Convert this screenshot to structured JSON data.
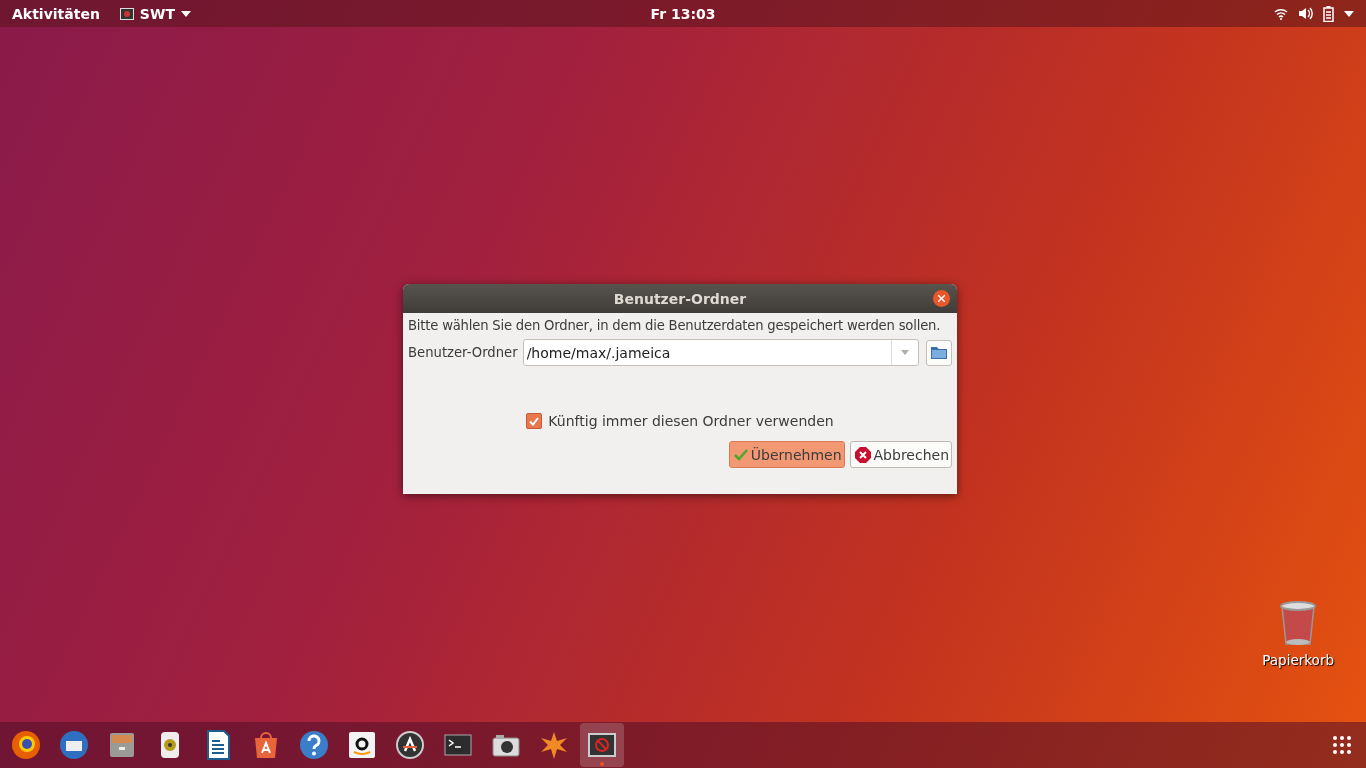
{
  "top_bar": {
    "activities": "Aktivitäten",
    "app_menu": "SWT",
    "clock": "Fr 13:03"
  },
  "dialog": {
    "title": "Benutzer-Ordner",
    "message": "Bitte wählen Sie den Ordner, in dem die Benutzerdaten gespeichert werden sollen.",
    "field_label": "Benutzer-Ordner",
    "path_value": "/home/max/.jameica",
    "remember": {
      "label": "Künftig immer diesen Ordner verwenden",
      "checked": true
    },
    "buttons": [
      {
        "label": "Übernehmen",
        "kind": "ok",
        "default": true
      },
      {
        "label": "Abbrechen",
        "kind": "cancel",
        "default": false
      }
    ]
  },
  "desktop_icons": [
    {
      "label": "Papierkorb"
    }
  ],
  "dock": [
    {
      "kind": "browser",
      "running": false
    },
    {
      "kind": "mail",
      "running": false
    },
    {
      "kind": "files",
      "running": false
    },
    {
      "kind": "speaker",
      "running": false
    },
    {
      "kind": "writer",
      "running": false
    },
    {
      "kind": "store",
      "running": false
    },
    {
      "kind": "help",
      "running": false
    },
    {
      "kind": "amazon",
      "running": false
    },
    {
      "kind": "updater",
      "running": false
    },
    {
      "kind": "terminal",
      "running": false
    },
    {
      "kind": "camera",
      "running": false
    },
    {
      "kind": "star",
      "running": false
    },
    {
      "kind": "app",
      "running": true
    }
  ]
}
